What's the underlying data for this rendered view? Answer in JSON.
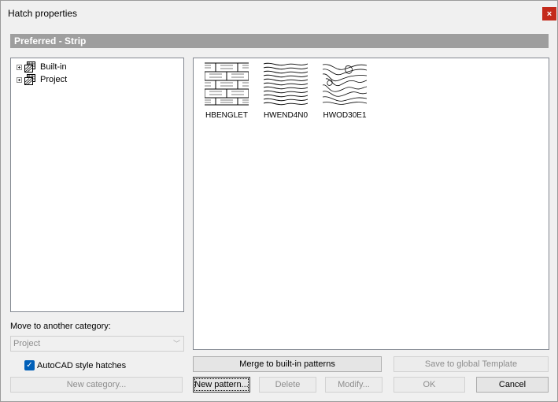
{
  "window": {
    "title": "Hatch properties",
    "close_glyph": "×"
  },
  "section_header": "Preferred - Strip",
  "tree": {
    "items": [
      {
        "label": "Built-in"
      },
      {
        "label": "Project"
      }
    ]
  },
  "patterns": [
    {
      "name": "HBENGLET"
    },
    {
      "name": "HWEND4N0"
    },
    {
      "name": "HWOD30E1"
    }
  ],
  "move_category": {
    "label": "Move to another category:",
    "selected": "Project"
  },
  "autocad_style": {
    "label": "AutoCAD style hatches",
    "checked": true
  },
  "buttons": {
    "new_category": "New category...",
    "merge": "Merge to built-in patterns",
    "save_template": "Save to global Template",
    "new_pattern": "New pattern...",
    "delete": "Delete",
    "modify": "Modify...",
    "ok": "OK",
    "cancel": "Cancel"
  }
}
